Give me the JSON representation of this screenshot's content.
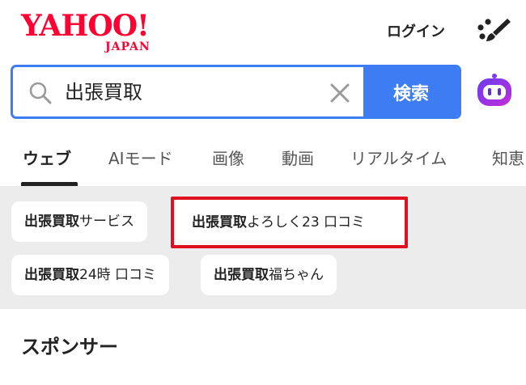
{
  "header": {
    "logo_main": "YAHOO!",
    "logo_sub": "JAPAN",
    "login_label": "ログイン",
    "brand_color": "#ff0033"
  },
  "search": {
    "query": "出張買取",
    "button_label": "検索",
    "accent_color": "#3d7cf2"
  },
  "tabs": [
    {
      "label": "ウェブ",
      "active": true
    },
    {
      "label": "AIモード"
    },
    {
      "label": "画像"
    },
    {
      "label": "動画"
    },
    {
      "label": "リアルタイム"
    },
    {
      "label": "知恵"
    }
  ],
  "suggestions": [
    {
      "bold": "出張買取",
      "rest": "サービス"
    },
    {
      "bold": "出張買取",
      "rest": "よろしく23 口コミ",
      "highlighted": true
    },
    {
      "bold": "出張買取",
      "rest": "24時 口コミ"
    },
    {
      "bold": "出張買取",
      "rest": "福ちゃん"
    }
  ],
  "section": {
    "sponsor_label": "スポンサー"
  },
  "icons": {
    "search": "search-icon",
    "clear": "clear-icon",
    "brush": "brush-icon",
    "assistant": "assistant-icon"
  }
}
